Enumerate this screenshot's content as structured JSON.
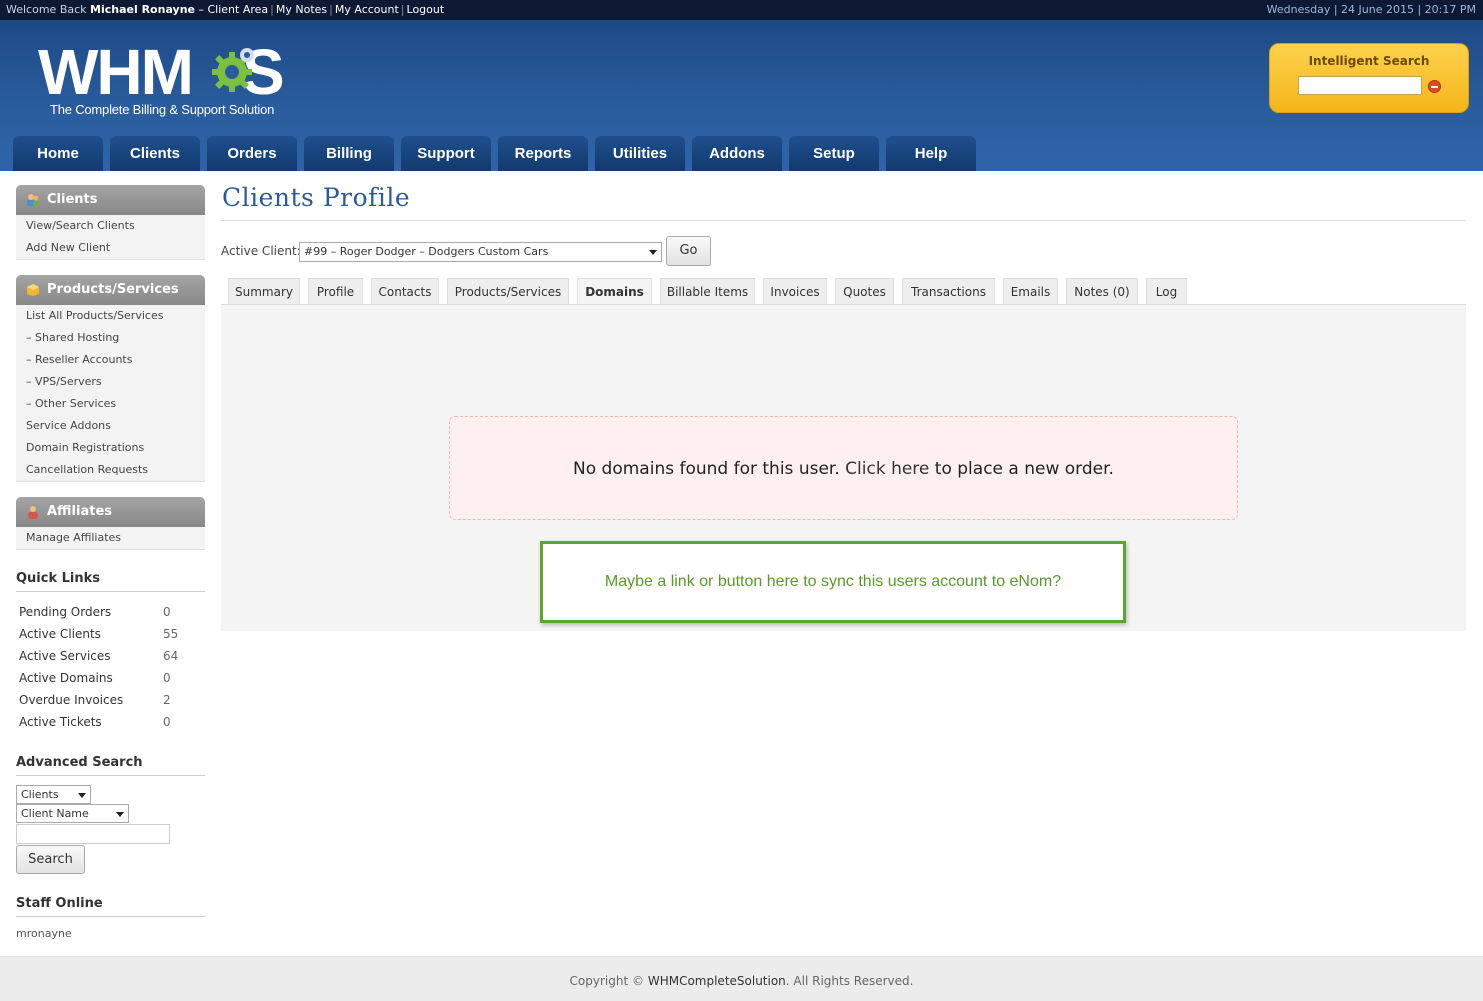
{
  "topbar": {
    "welcome": "Welcome Back",
    "user": "Michael Ronayne",
    "links": [
      "– Client Area",
      "My Notes",
      "My Account",
      "Logout"
    ],
    "date": "Wednesday | 24 June 2015 | 20:17 PM"
  },
  "header": {
    "logo_text": "WHMCS",
    "logo_tagline": "The Complete Billing & Support Solution",
    "search_title": "Intelligent Search",
    "search_value": ""
  },
  "nav": [
    "Home",
    "Clients",
    "Orders",
    "Billing",
    "Support",
    "Reports",
    "Utilities",
    "Addons",
    "Setup",
    "Help"
  ],
  "sidebar": {
    "clients": {
      "title": "Clients",
      "items": [
        "View/Search Clients",
        "Add New Client"
      ]
    },
    "products": {
      "title": "Products/Services",
      "items": [
        "List All Products/Services",
        "– Shared Hosting",
        "– Reseller Accounts",
        "– VPS/Servers",
        "– Other Services",
        "Service Addons",
        "Domain Registrations",
        "Cancellation Requests"
      ]
    },
    "affiliates": {
      "title": "Affiliates",
      "items": [
        "Manage Affiliates"
      ]
    },
    "quick_links": {
      "title": "Quick Links",
      "rows": [
        {
          "label": "Pending Orders",
          "count": "0"
        },
        {
          "label": "Active Clients",
          "count": "55"
        },
        {
          "label": "Active Services",
          "count": "64"
        },
        {
          "label": "Active Domains",
          "count": "0"
        },
        {
          "label": "Overdue Invoices",
          "count": "2"
        },
        {
          "label": "Active Tickets",
          "count": "0"
        }
      ]
    },
    "advanced_search": {
      "title": "Advanced Search",
      "type": "Clients",
      "field": "Client Name",
      "query": "",
      "button": "Search"
    },
    "staff_online": {
      "title": "Staff Online",
      "user": "mronayne"
    }
  },
  "main": {
    "title": "Clients Profile",
    "active_client_label": "Active Client:",
    "active_client_value": "#99 – Roger Dodger – Dodgers Custom Cars",
    "go": "Go",
    "tabs": [
      "Summary",
      "Profile",
      "Contacts",
      "Products/Services",
      "Domains",
      "Billable Items",
      "Invoices",
      "Quotes",
      "Transactions",
      "Emails",
      "Notes (0)",
      "Log"
    ],
    "active_tab": "Domains",
    "no_domains_pre": "No domains found for this user.",
    "click": "Click",
    "here": "here",
    "no_domains_post": "to place a new order.",
    "note": "Maybe a link or button here to sync this users account to eNom?"
  },
  "footer": {
    "pre": "Copyright ©",
    "company": "WHMCompleteSolution",
    "post": ". All Rights Reserved."
  },
  "colors": {
    "header_blue": "#2a5d9e",
    "nav_tab": "#1f4f8c",
    "search_gold": "#f5b51a",
    "title_blue": "#2d5a95",
    "note_green": "#5ca52d"
  }
}
